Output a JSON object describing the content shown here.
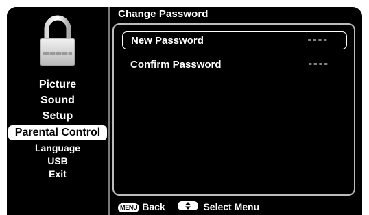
{
  "panel": {
    "title": "Change Password"
  },
  "sidebar": {
    "icon": "padlock-icon",
    "items": [
      {
        "label": "Picture"
      },
      {
        "label": "Sound"
      },
      {
        "label": "Setup"
      },
      {
        "label": "Parental Control",
        "active": true
      },
      {
        "label": "Language"
      },
      {
        "label": "USB"
      },
      {
        "label": "Exit"
      }
    ]
  },
  "fields": [
    {
      "label": "New Password",
      "value": "----",
      "selected": true
    },
    {
      "label": "Confirm Password",
      "value": "----",
      "selected": false
    }
  ],
  "footer": {
    "menu_key": "MENU",
    "back_label": "Back",
    "select_label": "Select Menu",
    "nav_icon": "up-down-arrows-icon"
  },
  "colors": {
    "background": "#000000",
    "text": "#ffffff",
    "highlight": "#ffffff",
    "border": "#bcbcbc"
  }
}
